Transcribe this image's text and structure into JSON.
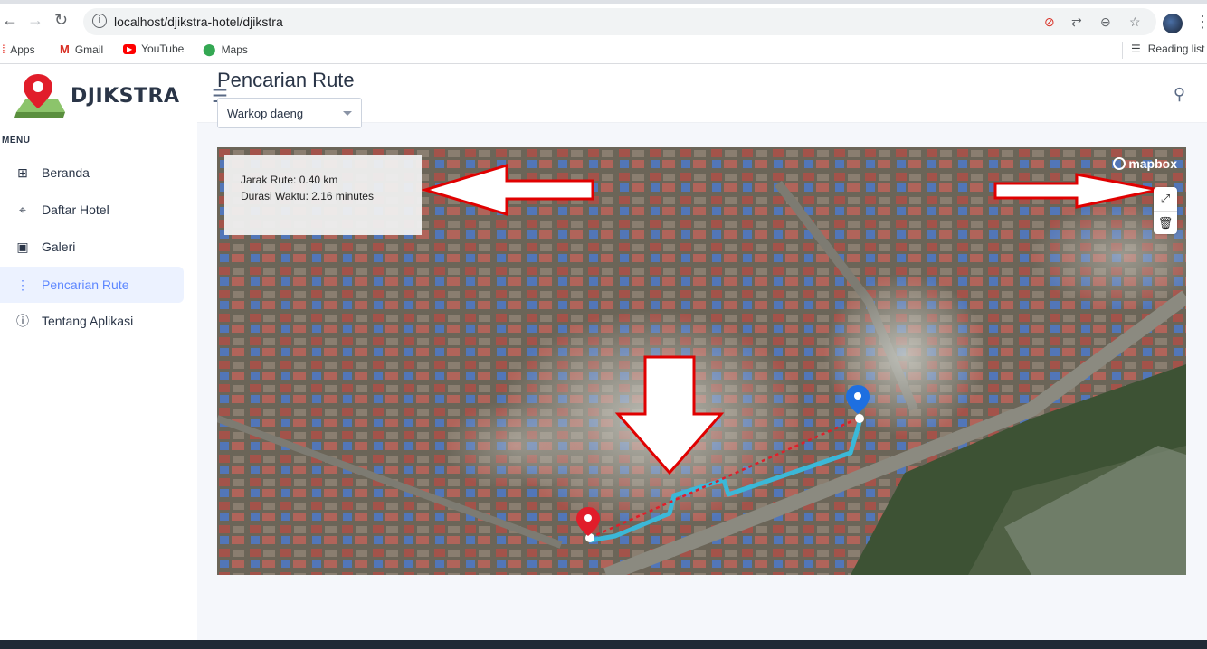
{
  "browser": {
    "url": "localhost/djikstra-hotel/djikstra",
    "bookmarks": [
      "Apps",
      "Gmail",
      "YouTube",
      "Maps"
    ],
    "reading_list": "Reading list"
  },
  "sidebar": {
    "brand": "DJIKSTRA",
    "menu_label": "MENU",
    "items": [
      {
        "label": "Beranda",
        "icon": "grid-icon",
        "active": false
      },
      {
        "label": "Daftar Hotel",
        "icon": "location-icon",
        "active": false
      },
      {
        "label": "Galeri",
        "icon": "image-icon",
        "active": false
      },
      {
        "label": "Pencarian Rute",
        "icon": "route-icon",
        "active": true
      },
      {
        "label": "Tentang Aplikasi",
        "icon": "info-icon",
        "active": false
      }
    ]
  },
  "main": {
    "title": "Pencarian Rute",
    "select_value": "Warkop daeng"
  },
  "map": {
    "distance_text": "Jarak Rute: 0.40 km",
    "duration_text": "Durasi Waktu: 2.16 minutes",
    "attribution": "mapbox",
    "controls": [
      "line-draw-icon",
      "trash-icon"
    ]
  },
  "colors": {
    "accent": "#5d87ff",
    "route": "#3bb8d8",
    "start_marker": "#e11d2a",
    "end_marker": "#1e6fe0",
    "annotation_arrow": "#e00000"
  }
}
